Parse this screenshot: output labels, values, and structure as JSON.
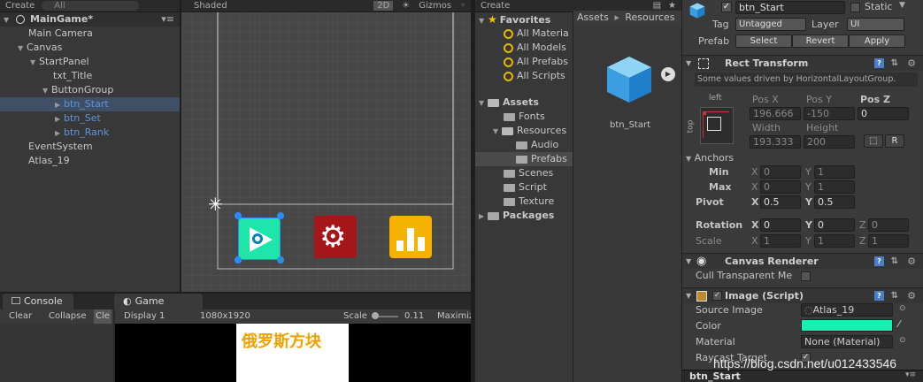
{
  "hierarchy": {
    "create_label": "Create",
    "search_placeholder": "All",
    "scene_name": "MainGame*",
    "items": [
      {
        "label": "Main Camera"
      },
      {
        "label": "Canvas"
      },
      {
        "label": "StartPanel"
      },
      {
        "label": "txt_Title"
      },
      {
        "label": "ButtonGroup"
      },
      {
        "label": "btn_Start"
      },
      {
        "label": "btn_Set"
      },
      {
        "label": "btn_Rank"
      },
      {
        "label": "EventSystem"
      },
      {
        "label": "Atlas_19"
      }
    ]
  },
  "scene": {
    "shading_mode": "Shaded",
    "mode_2d": "2D",
    "gizmos_label": "Gizmos"
  },
  "bottom": {
    "console_tab": "Console",
    "clear_label": "Clear",
    "collapse_label": "Collapse",
    "clear_on_play_label": "Cle",
    "game_tab": "Game",
    "display_label": "Display 1",
    "resolution": "1080x1920",
    "scale_label": "Scale",
    "scale_value": "0.11",
    "maximize_label": "Maximiz",
    "game_title": "俄罗斯方块"
  },
  "project": {
    "create_label": "Create",
    "favorites_label": "Favorites",
    "favorites": [
      "All Materia",
      "All Models",
      "All Prefabs",
      "All Scripts"
    ],
    "assets_label": "Assets",
    "folders": [
      "Fonts",
      "Resources",
      "Audio",
      "Prefabs",
      "Scenes",
      "Script",
      "Texture"
    ],
    "packages_label": "Packages",
    "breadcrumb": [
      "Assets",
      "Resources"
    ],
    "asset_name": "btn_Start"
  },
  "inspector": {
    "object_name": "btn_Start",
    "static_label": "Static",
    "tag_label": "Tag",
    "tag_value": "Untagged",
    "layer_label": "Layer",
    "layer_value": "UI",
    "prefab_label": "Prefab",
    "select_label": "Select",
    "revert_label": "Revert",
    "apply_label": "Apply",
    "rect_transform_title": "Rect Transform",
    "driven_note": "Some values driven by HorizontalLayoutGroup.",
    "anchor_h": "left",
    "anchor_v": "top",
    "posx_label": "Pos X",
    "posx": "196.666",
    "posy_label": "Pos Y",
    "posy": "-150",
    "posz_label": "Pos Z",
    "posz": "0",
    "width_label": "Width",
    "width": "193.333",
    "height_label": "Height",
    "height": "200",
    "r_label": "R",
    "anchors_label": "Anchors",
    "min_label": "Min",
    "min_x": "0",
    "min_y": "1",
    "max_label": "Max",
    "max_x": "0",
    "max_y": "1",
    "pivot_label": "Pivot",
    "pivot_x": "0.5",
    "pivot_y": "0.5",
    "rotation_label": "Rotation",
    "rot_x": "0",
    "rot_y": "0",
    "rot_z": "0",
    "scale_label": "Scale",
    "scale_x": "1",
    "scale_y": "1",
    "scale_z": "1",
    "x_letter": "X",
    "y_letter": "Y",
    "z_letter": "Z",
    "canvas_renderer_title": "Canvas Renderer",
    "cull_label": "Cull Transparent Me",
    "image_title": "Image (Script)",
    "source_image_label": "Source Image",
    "source_image_value": "Atlas_19",
    "color_label": "Color",
    "color_value": "#17f0b0",
    "material_label": "Material",
    "material_value": "None (Material)",
    "raycast_label": "Raycast Target",
    "footer_name": "btn_Start"
  },
  "watermark": "https://blog.csdn.net/u012433546",
  "colors": {
    "start_button": "#1ee6a8",
    "set_button": "#c0171b",
    "rank_button": "#f5b300",
    "game_title_color": "#f0a000"
  }
}
